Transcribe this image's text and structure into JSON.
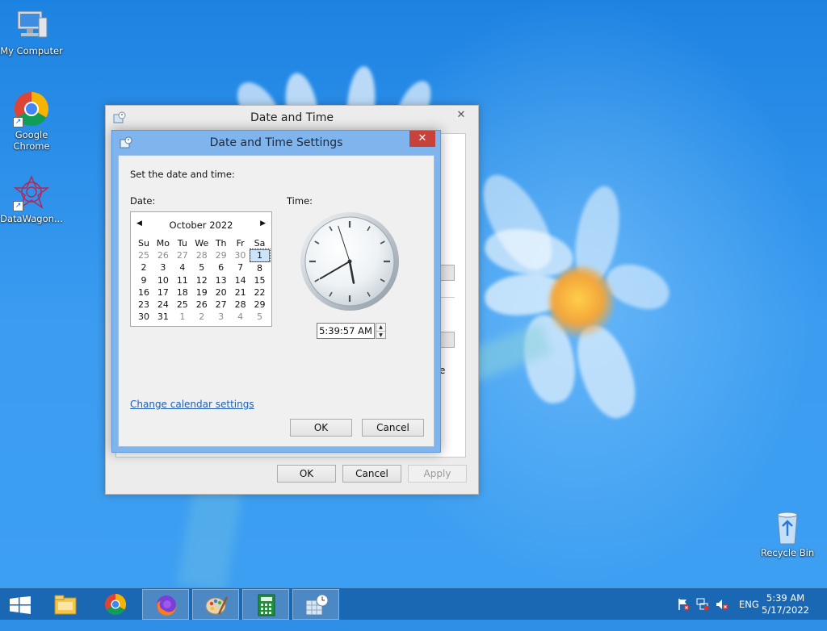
{
  "desktop": {
    "icons": [
      {
        "label": "My Computer",
        "icon": "computer-icon"
      },
      {
        "label": "Google Chrome",
        "icon": "chrome-icon"
      },
      {
        "label": "DataWagon...",
        "icon": "datawagon-icon"
      },
      {
        "label": "Recycle Bin",
        "icon": "recycle-bin-icon"
      }
    ]
  },
  "outer_window": {
    "title": "Date and Time",
    "close_label": "✕",
    "buttons": {
      "ok": "OK",
      "cancel": "Cancel",
      "apply": "Apply"
    },
    "partial_text": "e"
  },
  "inner_window": {
    "title": "Date and Time Settings",
    "close_label": "✕",
    "instruction": "Set the date and time:",
    "date_label": "Date:",
    "time_label": "Time:",
    "calendar": {
      "month_label": "October 2022",
      "prev": "◀",
      "next": "▶",
      "weekdays": [
        "Su",
        "Mo",
        "Tu",
        "We",
        "Th",
        "Fr",
        "Sa"
      ],
      "weeks": [
        [
          "25",
          "26",
          "27",
          "28",
          "29",
          "30",
          "1"
        ],
        [
          "2",
          "3",
          "4",
          "5",
          "6",
          "7",
          "8"
        ],
        [
          "9",
          "10",
          "11",
          "12",
          "13",
          "14",
          "15"
        ],
        [
          "16",
          "17",
          "18",
          "19",
          "20",
          "21",
          "22"
        ],
        [
          "23",
          "24",
          "25",
          "26",
          "27",
          "28",
          "29"
        ],
        [
          "30",
          "31",
          "1",
          "2",
          "3",
          "4",
          "5"
        ]
      ],
      "selected": "1"
    },
    "time": {
      "value": "5:39:57 AM",
      "hour": 5,
      "minute": 39,
      "second": 57
    },
    "change_calendar_link": "Change calendar settings",
    "buttons": {
      "ok": "OK",
      "cancel": "Cancel"
    }
  },
  "taskbar": {
    "items": [
      "start-icon",
      "file-explorer-icon",
      "chrome-icon",
      "firefox-icon",
      "paint-icon",
      "calculator-icon",
      "date-time-icon"
    ],
    "language": "ENG",
    "time": "5:39 AM",
    "date": "5/17/2022"
  },
  "colors": {
    "desktop_blue": "#2f8fe6",
    "taskbar": "#1a68b4",
    "inner_frame": "#7fb4ec",
    "close_red": "#c7423a",
    "link": "#1f5fb4"
  }
}
